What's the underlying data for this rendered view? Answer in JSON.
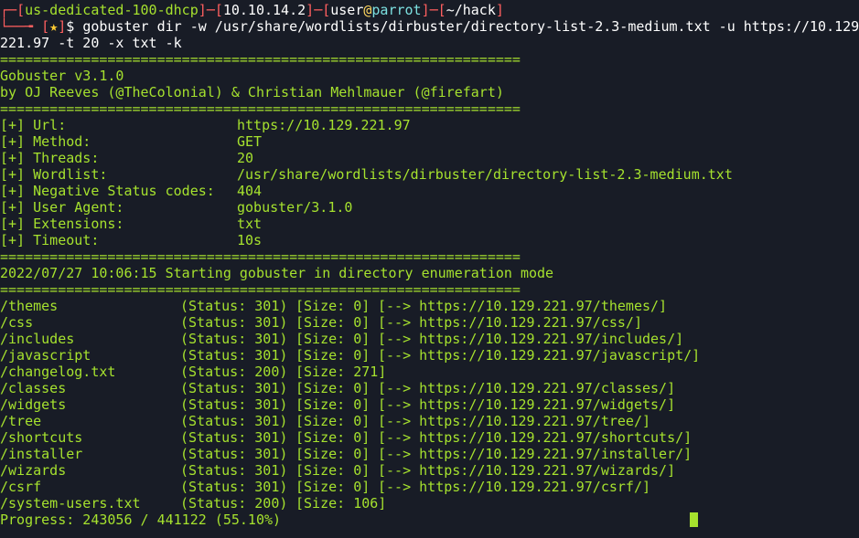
{
  "prompt": {
    "corner_top": "┌─",
    "corner_bottom": "└──╼ ",
    "lb": "[",
    "rb": "]",
    "dash": "─",
    "host": "us-dedicated-100-dhcp",
    "ip": "10.10.14.2",
    "user": "user",
    "at": "@",
    "machine": "parrot",
    "cwd": "~/hack",
    "star": "★",
    "dollar": "$ ",
    "command_line1": "gobuster dir -w /usr/share/wordlists/dirbuster/directory-list-2.3-medium.txt -u https://10.129.",
    "command_line2": "221.97 -t 20 -x txt -k"
  },
  "separator": "===============================================================",
  "banner": {
    "title": "Gobuster v3.1.0",
    "credits": "by OJ Reeves (@TheColonial) & Christian Mehlmauer (@firefart)"
  },
  "config": [
    {
      "key": "[+] Url:",
      "value": "https://10.129.221.97"
    },
    {
      "key": "[+] Method:",
      "value": "GET"
    },
    {
      "key": "[+] Threads:",
      "value": "20"
    },
    {
      "key": "[+] Wordlist:",
      "value": "/usr/share/wordlists/dirbuster/directory-list-2.3-medium.txt"
    },
    {
      "key": "[+] Negative Status codes:",
      "value": "404"
    },
    {
      "key": "[+] User Agent:",
      "value": "gobuster/3.1.0"
    },
    {
      "key": "[+] Extensions:",
      "value": "txt"
    },
    {
      "key": "[+] Timeout:",
      "value": "10s"
    }
  ],
  "start_message": "2022/07/27 10:06:15 Starting gobuster in directory enumeration mode",
  "results": [
    {
      "path": "/themes",
      "status": "(Status: 301)",
      "size": "[Size: 0]",
      "redirect": "[--> https://10.129.221.97/themes/]"
    },
    {
      "path": "/css",
      "status": "(Status: 301)",
      "size": "[Size: 0]",
      "redirect": "[--> https://10.129.221.97/css/]"
    },
    {
      "path": "/includes",
      "status": "(Status: 301)",
      "size": "[Size: 0]",
      "redirect": "[--> https://10.129.221.97/includes/]"
    },
    {
      "path": "/javascript",
      "status": "(Status: 301)",
      "size": "[Size: 0]",
      "redirect": "[--> https://10.129.221.97/javascript/]"
    },
    {
      "path": "/changelog.txt",
      "status": "(Status: 200)",
      "size": "[Size: 271]",
      "redirect": ""
    },
    {
      "path": "/classes",
      "status": "(Status: 301)",
      "size": "[Size: 0]",
      "redirect": "[--> https://10.129.221.97/classes/]"
    },
    {
      "path": "/widgets",
      "status": "(Status: 301)",
      "size": "[Size: 0]",
      "redirect": "[--> https://10.129.221.97/widgets/]"
    },
    {
      "path": "/tree",
      "status": "(Status: 301)",
      "size": "[Size: 0]",
      "redirect": "[--> https://10.129.221.97/tree/]"
    },
    {
      "path": "/shortcuts",
      "status": "(Status: 301)",
      "size": "[Size: 0]",
      "redirect": "[--> https://10.129.221.97/shortcuts/]"
    },
    {
      "path": "/installer",
      "status": "(Status: 301)",
      "size": "[Size: 0]",
      "redirect": "[--> https://10.129.221.97/installer/]"
    },
    {
      "path": "/wizards",
      "status": "(Status: 301)",
      "size": "[Size: 0]",
      "redirect": "[--> https://10.129.221.97/wizards/]"
    },
    {
      "path": "/csrf",
      "status": "(Status: 301)",
      "size": "[Size: 0]",
      "redirect": "[--> https://10.129.221.97/csrf/]"
    },
    {
      "path": "/system-users.txt",
      "status": "(Status: 200)",
      "size": "[Size: 106]",
      "redirect": ""
    }
  ],
  "progress": "Progress: 243056 / 441122 (55.10%)",
  "colors": {
    "background": "#181c26",
    "text_green": "#a6e22e",
    "prompt_red": "#ff5f5f",
    "prompt_cyan": "#7ce0e0",
    "star_yellow": "#ffcc33",
    "text_white": "#ffffff"
  }
}
